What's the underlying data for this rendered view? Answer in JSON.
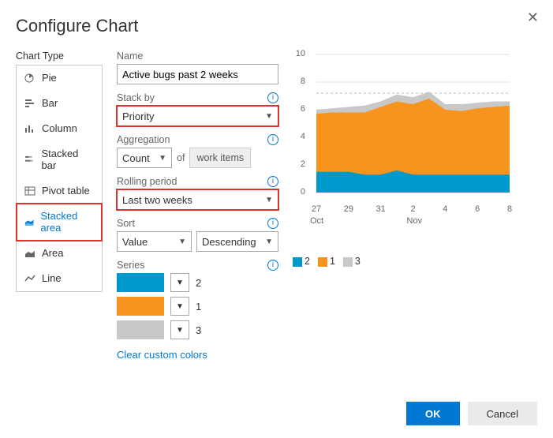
{
  "dialog": {
    "title": "Configure Chart",
    "close_icon": "✕"
  },
  "chart_type": {
    "label": "Chart Type",
    "items": [
      {
        "icon": "pie",
        "label": "Pie"
      },
      {
        "icon": "bar",
        "label": "Bar"
      },
      {
        "icon": "column",
        "label": "Column"
      },
      {
        "icon": "stackedbar",
        "label": "Stacked bar"
      },
      {
        "icon": "pivot",
        "label": "Pivot table"
      },
      {
        "icon": "stackedarea",
        "label": "Stacked area"
      },
      {
        "icon": "area",
        "label": "Area"
      },
      {
        "icon": "line",
        "label": "Line"
      }
    ],
    "selected_index": 5
  },
  "form": {
    "name_label": "Name",
    "name_value": "Active bugs past 2 weeks",
    "stack_by_label": "Stack by",
    "stack_by_value": "Priority",
    "aggregation_label": "Aggregation",
    "aggregation_value": "Count",
    "of_label": "of",
    "of_value": "work items",
    "rolling_label": "Rolling period",
    "rolling_value": "Last two weeks",
    "sort_label": "Sort",
    "sort_field": "Value",
    "sort_dir": "Descending",
    "series_label": "Series",
    "series": [
      {
        "color": "#0099cc",
        "label": "2"
      },
      {
        "color": "#f7941d",
        "label": "1"
      },
      {
        "color": "#c8c8c8",
        "label": "3"
      }
    ],
    "clear_colors": "Clear custom colors"
  },
  "buttons": {
    "ok": "OK",
    "cancel": "Cancel"
  },
  "chart_data": {
    "type": "area",
    "stacked": true,
    "ylim": [
      0,
      10
    ],
    "yticks": [
      0,
      2,
      4,
      6,
      8,
      10
    ],
    "x": [
      "27",
      "29",
      "31",
      "2",
      "4",
      "6",
      "8"
    ],
    "x_month_labels": [
      {
        "pos": 0,
        "text": "Oct"
      },
      {
        "pos": 3,
        "text": "Nov"
      }
    ],
    "series": [
      {
        "name": "2",
        "color": "#0099cc",
        "values": [
          1.5,
          1.5,
          1.5,
          1.3,
          1.3,
          1.6,
          1.3,
          1.3,
          1.3,
          1.3,
          1.3,
          1.3,
          1.3
        ]
      },
      {
        "name": "1",
        "color": "#f7941d",
        "values": [
          4.2,
          4.3,
          4.3,
          4.5,
          4.9,
          5.0,
          5.1,
          5.5,
          4.7,
          4.6,
          4.8,
          4.9,
          5.0
        ]
      },
      {
        "name": "3",
        "color": "#c8c8c8",
        "values": [
          0.3,
          0.3,
          0.4,
          0.5,
          0.4,
          0.5,
          0.5,
          0.5,
          0.4,
          0.5,
          0.4,
          0.4,
          0.3
        ]
      }
    ],
    "legend_order": [
      "2",
      "1",
      "3"
    ]
  }
}
